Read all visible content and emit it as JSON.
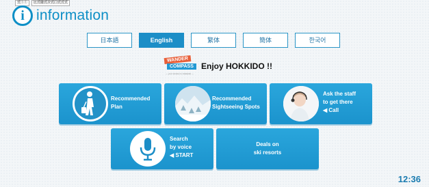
{
  "browser_tabs": [
    "式①①",
    "比式徽式次式口式式式"
  ],
  "header": {
    "title": "information",
    "icon_glyph": "i"
  },
  "languages": [
    {
      "label": "日本語",
      "active": false
    },
    {
      "label": "English",
      "active": true
    },
    {
      "label": "繁体",
      "active": false
    },
    {
      "label": "簡体",
      "active": false
    },
    {
      "label": "한국어",
      "active": false
    }
  ],
  "brand": {
    "logo_line1": "WANDER",
    "logo_line2": "COMPASS",
    "logo_tagline": "— your window to Hokkaido —",
    "headline": "Enjoy HOKKIDO !!"
  },
  "tiles": {
    "recommended_plan": {
      "line1": "Recommended",
      "line2": "Plan"
    },
    "sightseeing": {
      "line1": "Recommended",
      "line2": "Sightseeing Spots"
    },
    "ask_staff": {
      "line1": "Ask the staff",
      "line2": "to get there",
      "line3": "◀ Call"
    },
    "voice_search": {
      "line1": "Search",
      "line2": "by voice",
      "line3": "◀ START"
    },
    "ski_deals": {
      "line1": "Deals on",
      "line2": "ski resorts"
    }
  },
  "clock": "12:36",
  "colors": {
    "accent": "#1c8ec7",
    "tile": "#2aa6dc",
    "logo_orange": "#e8603a"
  }
}
